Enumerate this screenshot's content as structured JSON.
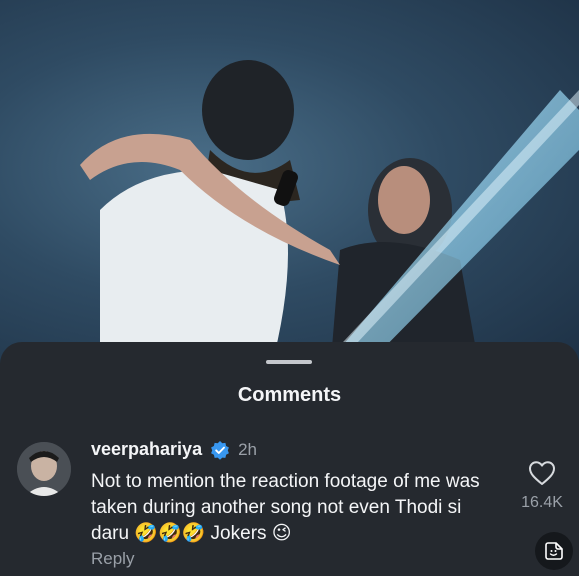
{
  "sheet": {
    "title": "Comments"
  },
  "comment": {
    "username": "veerpahariya",
    "time": "2h",
    "text": "Not to mention the reaction footage of me was taken during another song not even Thodi si daru 🤣🤣🤣 Jokers 😉",
    "reply_label": "Reply",
    "like_count": "16.4K",
    "verified": true
  },
  "colors": {
    "sheet_bg": "#25292f",
    "verified_blue": "#3897f0",
    "secondary_text": "#9aa0a8"
  },
  "icons": {
    "like": "heart-outline-icon",
    "verified": "verified-badge-icon",
    "sticker": "sticker-icon",
    "handle": "drag-handle"
  }
}
